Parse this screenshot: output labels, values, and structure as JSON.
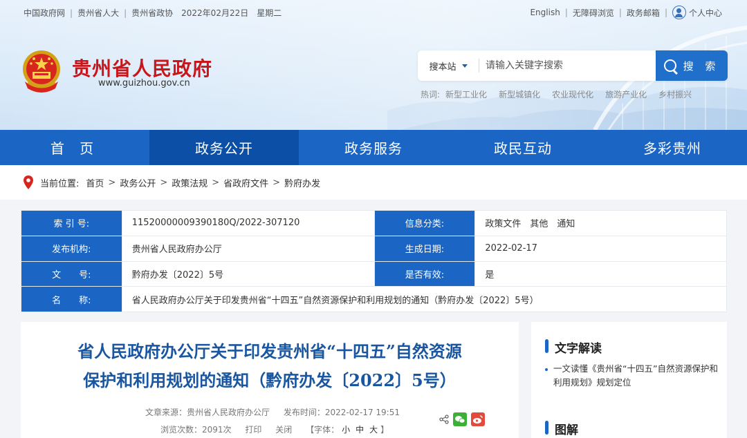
{
  "topbar": {
    "links": [
      "中国政府网",
      "贵州省人大",
      "贵州省政协"
    ],
    "date": "2022年02月22日",
    "weekday": "星期二",
    "right_links": [
      "English",
      "无障碍浏览",
      "政务邮箱"
    ],
    "user_center": "个人中心"
  },
  "site": {
    "title": "贵州省人民政府",
    "url": "www.guizhou.gov.cn"
  },
  "search": {
    "scope": "搜本站",
    "placeholder": "请输入关键字搜索",
    "button": "搜 索"
  },
  "hot": {
    "label": "热词:",
    "words": [
      "新型工业化",
      "新型城镇化",
      "农业现代化",
      "旅游产业化",
      "乡村振兴"
    ]
  },
  "nav": {
    "items": [
      "首 页",
      "政务公开",
      "政务服务",
      "政民互动",
      "多彩贵州"
    ],
    "active_index": 1
  },
  "breadcrumb": {
    "label": "当前位置:",
    "items": [
      "首页",
      "政务公开",
      "政策法规",
      "省政府文件",
      "黔府办发"
    ]
  },
  "info": {
    "index_key": "索 引 号:",
    "index_val": "11520000009390180Q/2022-307120",
    "category_key": "信息分类:",
    "category_val": "政策文件　其他　通知",
    "publisher_key": "发布机构:",
    "publisher_val": "贵州省人民政府办公厅",
    "date_key": "生成日期:",
    "date_val": "2022-02-17",
    "docno_key": "文　　号:",
    "docno_val": "黔府办发〔2022〕5号",
    "valid_key": "是否有效:",
    "valid_val": "是",
    "name_key": "名　　称:",
    "name_val": "省人民政府办公厅关于印发贵州省“十四五”自然资源保护和利用规划的通知（黔府办发〔2022〕5号）"
  },
  "article": {
    "title_line1": "省人民政府办公厅关于印发贵州省“十四五”自然资源",
    "title_line2": "保护和利用规划的通知（黔府办发〔2022〕5号）",
    "source": "文章来源：贵州省人民政府办公厅",
    "publish_time": "发布时间：2022-02-17 19:51",
    "views": "浏览次数：2091次",
    "print": "打印",
    "close": "关闭",
    "font_label": "【字体：",
    "font_small": "小",
    "font_medium": "中",
    "font_large": "大",
    "font_end": "】"
  },
  "sidebar": {
    "section1": "文字解读",
    "item1": "一文读懂《贵州省“十四五”自然资源保护和利用规划》规划定位",
    "section2": "图解"
  },
  "colors": {
    "nav_blue": "#1b65c5",
    "nav_active": "#0c4fa6",
    "title_red": "#c8161d",
    "article_title": "#1a56a0"
  }
}
